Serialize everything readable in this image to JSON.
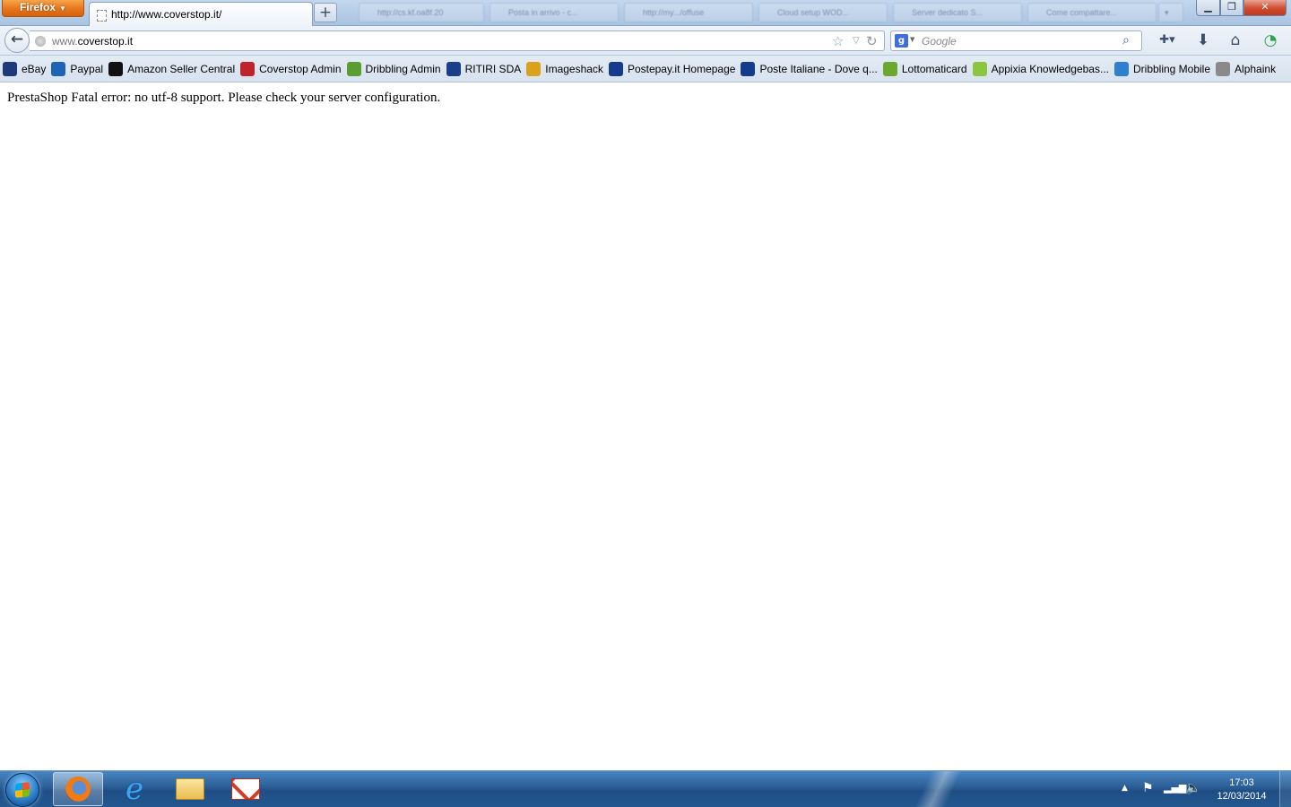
{
  "browser": {
    "menu_button": "Firefox",
    "active_tab": {
      "title": "http://www.coverstop.it/"
    },
    "background_tabs": [
      "http://cs.kf.oa8f.20",
      "Posta in arrivo - c...",
      "http://my.../offuse",
      "Cloud setup WOD...",
      "Server dedicato S...",
      "Come compattare..."
    ],
    "new_tab_label": "+"
  },
  "navbar": {
    "url_prefix": "www.",
    "url_domain": "coverstop.it",
    "search_placeholder": "Google",
    "search_engine_glyph": "g"
  },
  "bookmarks": [
    {
      "label": "eBay",
      "icon": "ebay-icon",
      "color": "#1f3a7a"
    },
    {
      "label": "Paypal",
      "icon": "paypal-icon",
      "color": "#1f63b4"
    },
    {
      "label": "Amazon Seller Central",
      "icon": "amazon-icon",
      "color": "#111111"
    },
    {
      "label": "Coverstop Admin",
      "icon": "coverstop-icon",
      "color": "#c0242b"
    },
    {
      "label": "Dribbling Admin",
      "icon": "dribbling-icon",
      "color": "#5a9e2f"
    },
    {
      "label": "RITIRI SDA",
      "icon": "sda-icon",
      "color": "#1a3f8a"
    },
    {
      "label": "Imageshack",
      "icon": "imageshack-icon",
      "color": "#d9a21a"
    },
    {
      "label": "Postepay.it Homepage",
      "icon": "postepay-icon",
      "color": "#143b8c"
    },
    {
      "label": "Poste Italiane - Dove q...",
      "icon": "poste-icon",
      "color": "#143b8c"
    },
    {
      "label": "Lottomaticard",
      "icon": "lottomatica-icon",
      "color": "#6aa82e"
    },
    {
      "label": "Appixia Knowledgebas...",
      "icon": "appixia-icon",
      "color": "#8cc63f"
    },
    {
      "label": "Dribbling Mobile",
      "icon": "dribbling-mobile-icon",
      "color": "#2f7fd0"
    },
    {
      "label": "Alphaink",
      "icon": "alphaink-icon",
      "color": "#8a8a8a"
    }
  ],
  "page": {
    "error_message": "PrestaShop Fatal error: no utf-8 support. Please check your server configuration."
  },
  "taskbar": {
    "pinned": [
      {
        "name": "firefox",
        "active": true
      },
      {
        "name": "internet-explorer",
        "active": false
      },
      {
        "name": "windows-explorer",
        "active": false
      },
      {
        "name": "mail",
        "active": false
      }
    ],
    "clock_time": "17:03",
    "clock_date": "12/03/2014"
  }
}
